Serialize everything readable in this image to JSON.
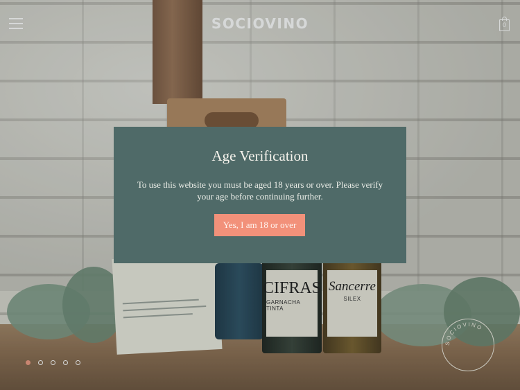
{
  "header": {
    "logo": "SOCIOVINO",
    "menu_icon": "hamburger-menu-icon",
    "cart_icon": "shopping-bag-icon",
    "cart_count": "0"
  },
  "hero": {
    "bottles": [
      {
        "label_main": "CIFRAS",
        "label_sub": "GARNACHA TINTA"
      },
      {
        "label_main": "Sancerre",
        "label_sub": "SILEX"
      }
    ],
    "stamp_text": "SOCIOVINO",
    "carousel": {
      "count": 5,
      "active_index": 0
    }
  },
  "age_modal": {
    "title": "Age Verification",
    "message": "To use this website you must be aged 18 years or over. Please verify your age before continuing further.",
    "confirm_label": "Yes, I am 18 or over"
  },
  "colors": {
    "modal_bg": "#4f6a68",
    "button_bg": "#f2917a",
    "active_dot": "#f09a82"
  }
}
